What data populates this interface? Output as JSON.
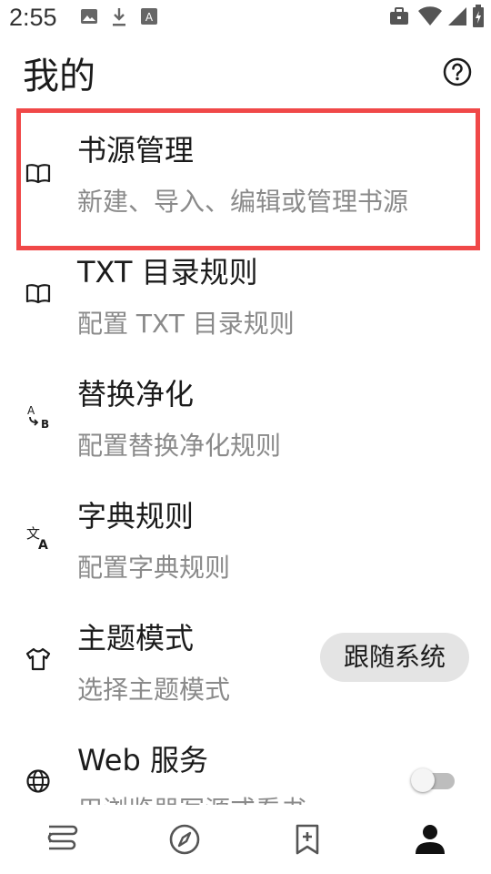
{
  "status_bar": {
    "time": "2:55",
    "left_icons": [
      "image-icon",
      "download-icon",
      "font-icon"
    ],
    "right_icons": [
      "briefcase-icon",
      "wifi-icon",
      "signal-icon",
      "battery-icon"
    ]
  },
  "page": {
    "title": "我的",
    "help_icon": "help-circle-icon"
  },
  "items": [
    {
      "title": "书源管理",
      "subtitle": "新建、导入、编辑或管理书源",
      "icon": "book-open-icon"
    },
    {
      "title": "TXT 目录规则",
      "subtitle": "配置 TXT 目录规则",
      "icon": "book-open-icon"
    },
    {
      "title": "替换净化",
      "subtitle": "配置替换净化规则",
      "icon": "replace-ab-icon"
    },
    {
      "title": "字典规则",
      "subtitle": "配置字典规则",
      "icon": "translate-icon"
    },
    {
      "title": "主题模式",
      "subtitle": "选择主题模式",
      "icon": "shirt-icon",
      "value": "跟随系统"
    },
    {
      "title": "Web 服务",
      "subtitle": "用浏览器写源或看书",
      "icon": "globe-icon",
      "toggle_on": false
    }
  ],
  "highlight_color": "#f04848",
  "bottom_nav": [
    {
      "name": "bookshelf",
      "icon": "bookshelf-icon",
      "selected": false
    },
    {
      "name": "explore",
      "icon": "compass-icon",
      "selected": false
    },
    {
      "name": "rss",
      "icon": "bookmark-add-icon",
      "selected": false
    },
    {
      "name": "my",
      "icon": "person-icon",
      "selected": true
    }
  ]
}
